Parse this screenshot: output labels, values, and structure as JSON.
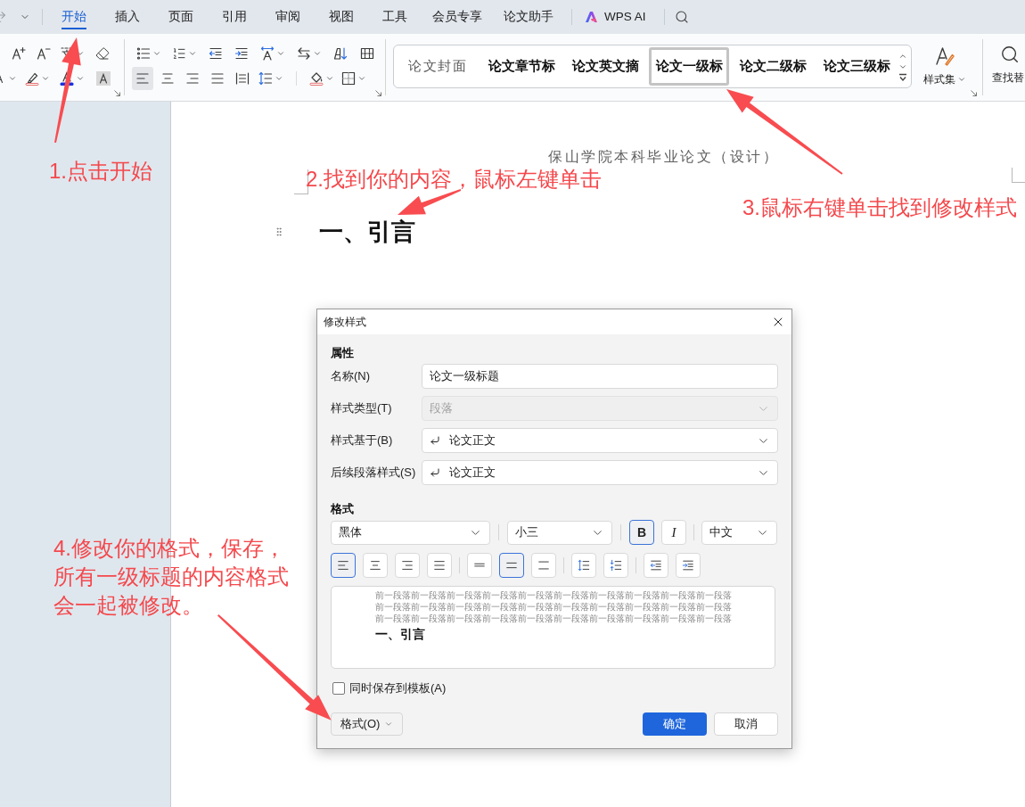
{
  "top_bar": {
    "tabs": [
      {
        "label": "开始",
        "selected": true
      },
      {
        "label": "插入",
        "selected": false
      },
      {
        "label": "页面",
        "selected": false
      },
      {
        "label": "引用",
        "selected": false
      },
      {
        "label": "审阅",
        "selected": false
      },
      {
        "label": "视图",
        "selected": false
      },
      {
        "label": "工具",
        "selected": false
      },
      {
        "label": "会员专享",
        "selected": false
      },
      {
        "label": "论文助手",
        "selected": false
      }
    ],
    "ai_button": "WPS AI"
  },
  "ribbon": {
    "alignment": [
      {
        "selected": true
      },
      {
        "selected": false
      },
      {
        "selected": false
      },
      {
        "selected": false
      },
      {
        "selected": false
      }
    ],
    "style_gallery": [
      {
        "label": "论文封面",
        "kind": "plain",
        "selected": false
      },
      {
        "label": "论文章节标",
        "kind": "bold",
        "selected": false
      },
      {
        "label": "论文英文摘",
        "kind": "bold",
        "selected": false
      },
      {
        "label": "论文一级标",
        "kind": "bold",
        "selected": true
      },
      {
        "label": "论文二级标",
        "kind": "bold",
        "selected": false
      },
      {
        "label": "论文三级标",
        "kind": "bold",
        "selected": false
      }
    ],
    "style_set_button": "样式集",
    "find_button": "查找替"
  },
  "document": {
    "page_header": "保山学院本科毕业论文（设计）",
    "heading": "一、引言"
  },
  "dialog": {
    "title": "修改样式",
    "properties": {
      "heading": "属性",
      "fields": [
        {
          "label": "名称(N)",
          "kind": "text",
          "value": "论文一级标题",
          "disabled": false
        },
        {
          "label": "样式类型(T)",
          "kind": "select",
          "value": "段落",
          "disabled": true
        },
        {
          "label": "样式基于(B)",
          "kind": "style_select",
          "value": "论文正文",
          "disabled": false
        },
        {
          "label": "后续段落样式(S)",
          "kind": "style_select",
          "value": "论文正文",
          "disabled": false
        }
      ]
    },
    "format": {
      "heading": "格式",
      "font": "黑体",
      "size": "小三",
      "bold": {
        "label": "B",
        "selected": true
      },
      "italic": {
        "label": "I",
        "selected": false
      },
      "language": "中文",
      "alignment": [
        {
          "selected": true
        },
        {
          "selected": false
        },
        {
          "selected": false
        },
        {
          "selected": false
        }
      ],
      "line_spacing": [
        {
          "selected": false
        },
        {
          "selected": true
        },
        {
          "selected": false
        }
      ]
    },
    "preview": {
      "previous_paragraph": "前一段落前一段落前一段落前一段落前一段落前一段落前一段落前一段落前一段落前一段落前一段落前一段落前一段落前一段落前一段落前一段落前一段落前一段落前一段落前一段落前一段落前一段落前一段落前一段落前一段落前一段落前一段落前一段落前一段落前一段落",
      "sample": "一、引言"
    },
    "save_to_template": {
      "label": "同时保存到模板(A)",
      "checked": false
    },
    "format_menu_button": "格式(O)",
    "ok_button": "确定",
    "cancel_button": "取消"
  },
  "annotations": [
    {
      "text": "1.点击开始"
    },
    {
      "text": "2.找到你的内容，鼠标左键单击"
    },
    {
      "text": "3.鼠标右键单击找到修改样式"
    },
    {
      "text": "4.修改你的格式，保存，所有一级标题的内容格式会一起被修改。"
    }
  ]
}
